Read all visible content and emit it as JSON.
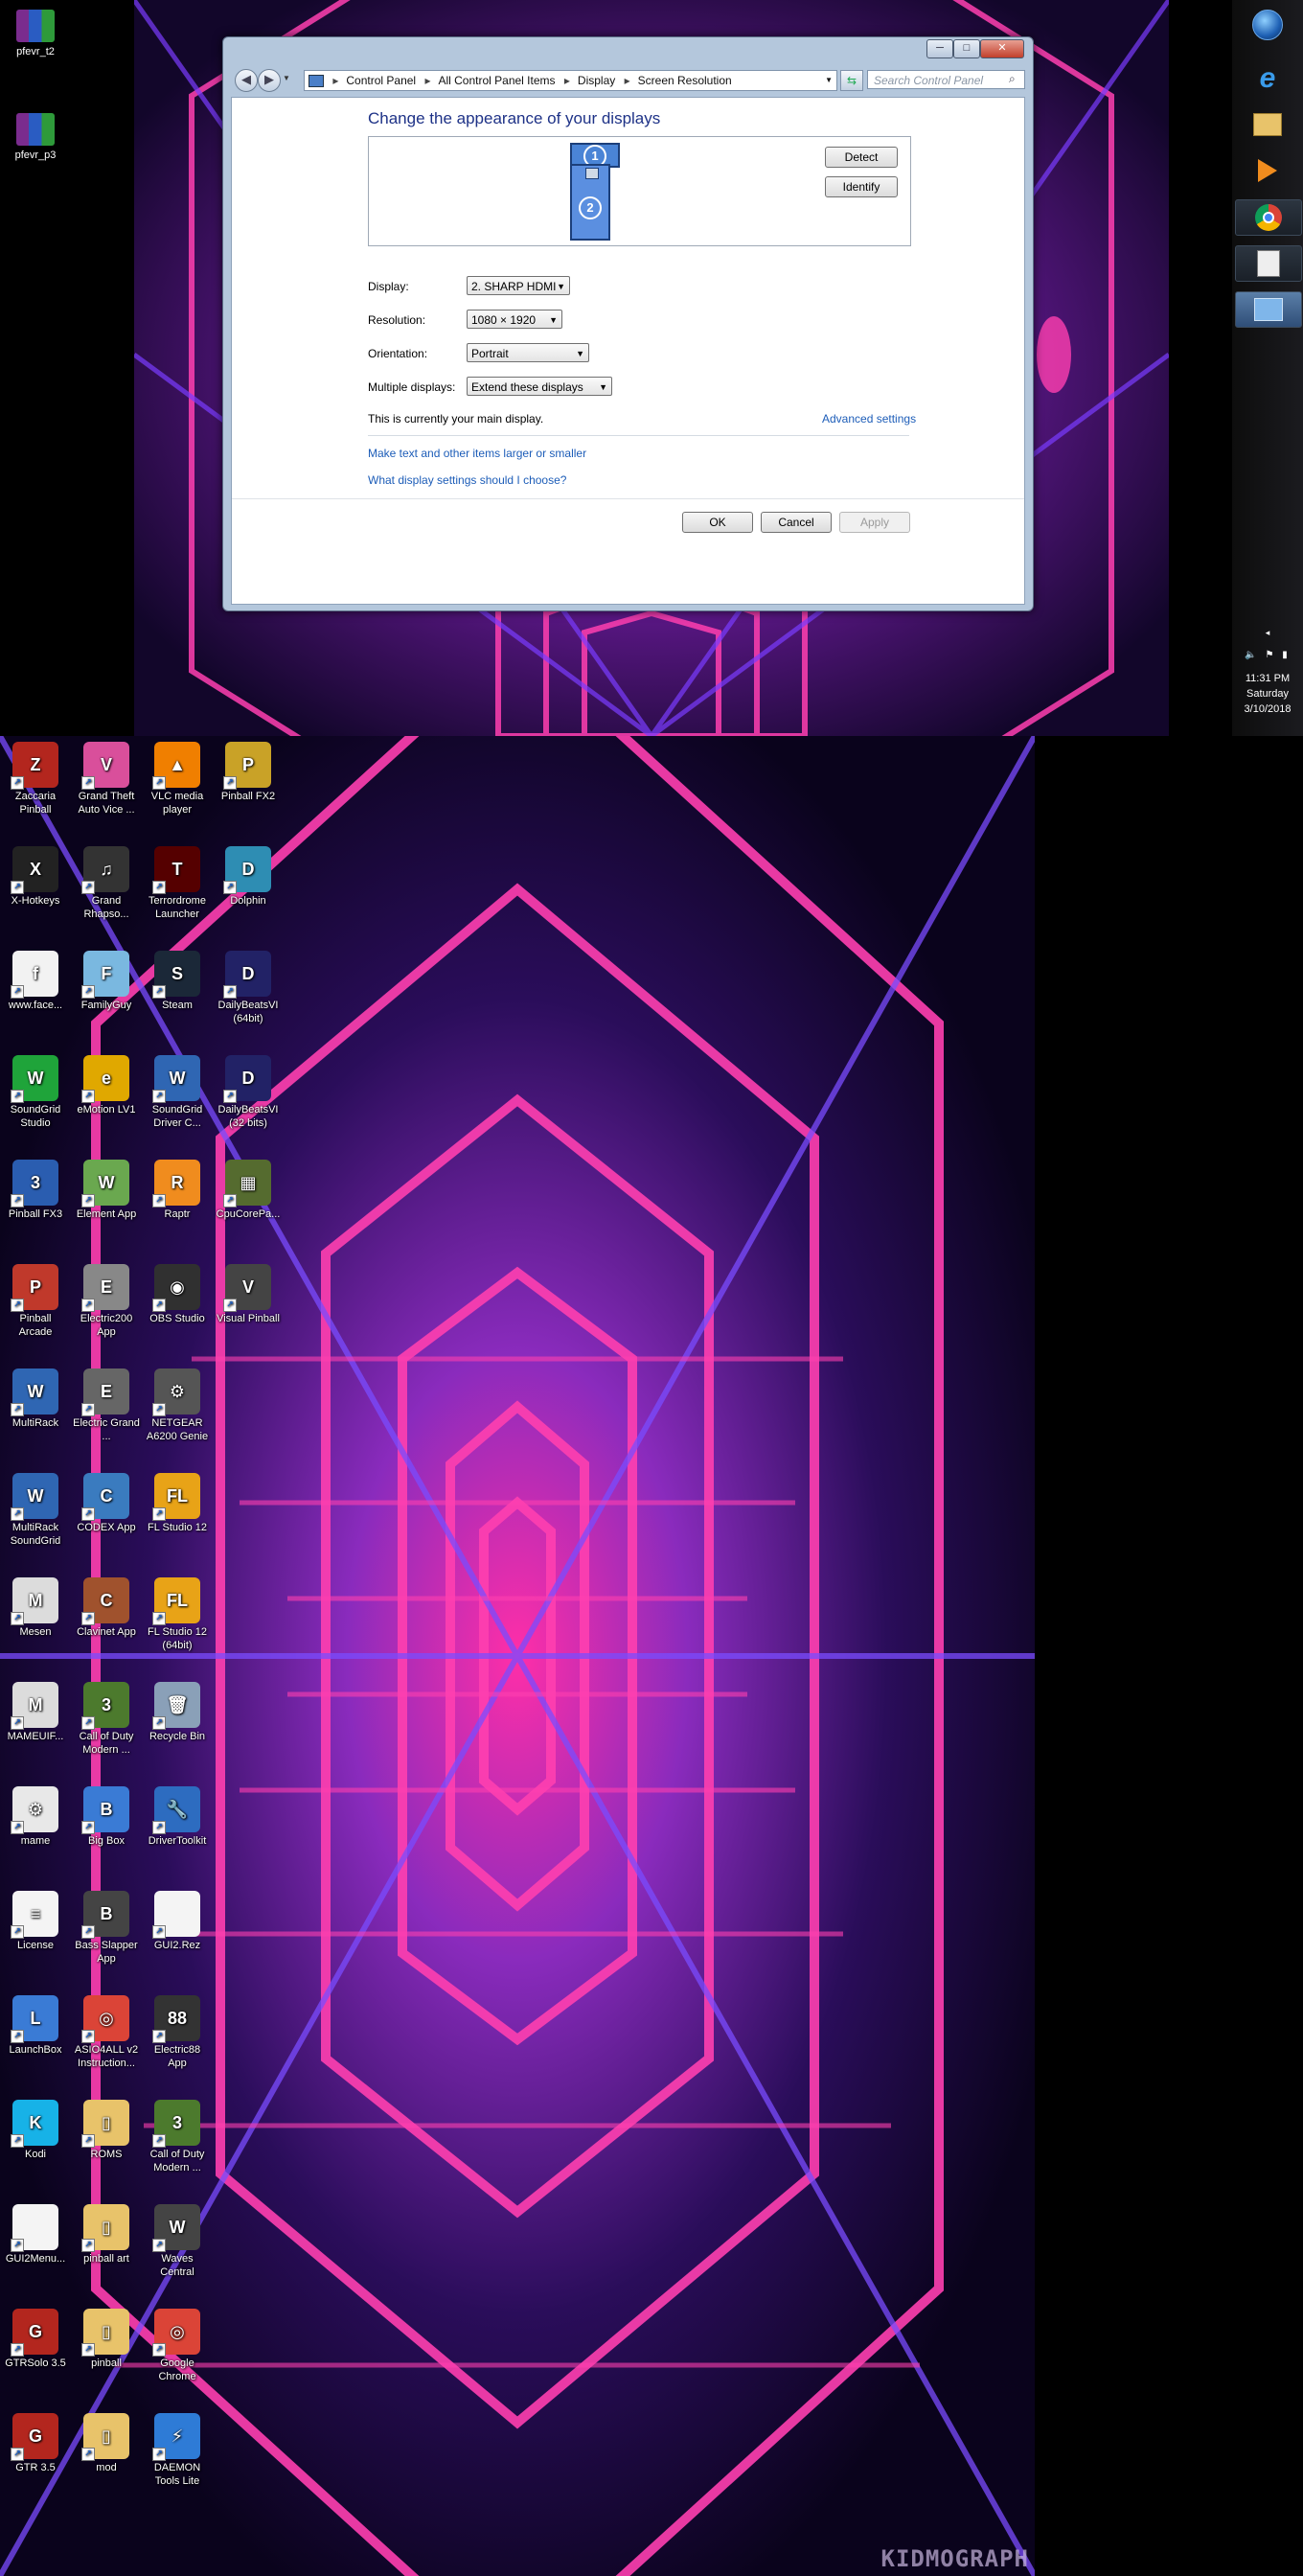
{
  "top_desktop_icons": [
    {
      "label": "pfevr_t2",
      "icon": "winrar-archive-icon"
    },
    {
      "label": "pfevr_p3",
      "icon": "winrar-archive-icon"
    }
  ],
  "window": {
    "breadcrumbs": [
      "Control Panel",
      "All Control Panel Items",
      "Display",
      "Screen Resolution"
    ],
    "search_placeholder": "Search Control Panel",
    "heading": "Change the appearance of your displays",
    "monitor_1": "1",
    "monitor_2": "2",
    "detect_label": "Detect",
    "identify_label": "Identify",
    "fields": {
      "display_label": "Display:",
      "display_value": "2. SHARP HDMI",
      "resolution_label": "Resolution:",
      "resolution_value": "1080 × 1920",
      "orientation_label": "Orientation:",
      "orientation_value": "Portrait",
      "multiple_label": "Multiple displays:",
      "multiple_value": "Extend these displays"
    },
    "main_display_note": "This is currently your main display.",
    "advanced_link": "Advanced settings",
    "link_larger_text": "Make text and other items larger or smaller",
    "link_which_settings": "What display settings should I choose?",
    "ok_label": "OK",
    "cancel_label": "Cancel",
    "apply_label": "Apply"
  },
  "taskbar": {
    "items": [
      "start-orb-icon",
      "internet-explorer-icon",
      "file-explorer-icon",
      "media-player-icon",
      "chrome-icon",
      "app-icon",
      "network-app-icon"
    ],
    "clock_time": "11:31 PM",
    "clock_day": "Saturday",
    "clock_date": "3/10/2018"
  },
  "desktop_icons": [
    {
      "label": "Zaccaria Pinball",
      "color": "#b3261e",
      "glyph": "Z"
    },
    {
      "label": "Grand Theft Auto Vice ...",
      "color": "#d94f9b",
      "glyph": "V"
    },
    {
      "label": "VLC media player",
      "color": "#f07f00",
      "glyph": "▲"
    },
    {
      "label": "Pinball FX2",
      "color": "#c9a227",
      "glyph": "P"
    },
    {
      "label": "X-Hotkeys",
      "color": "#222222",
      "glyph": "X"
    },
    {
      "label": "Grand Rhapso...",
      "color": "#333333",
      "glyph": "♫"
    },
    {
      "label": "Terrordrome Launcher",
      "color": "#550000",
      "glyph": "T"
    },
    {
      "label": "Dolphin",
      "color": "#2e8db3",
      "glyph": "D"
    },
    {
      "label": "www.face...",
      "color": "#f2f2f2",
      "glyph": "f"
    },
    {
      "label": "FamilyGuy",
      "color": "#7ab8e0",
      "glyph": "F"
    },
    {
      "label": "Steam",
      "color": "#1b2838",
      "glyph": "S"
    },
    {
      "label": "DailyBeatsVI (64bit)",
      "color": "#222266",
      "glyph": "D"
    },
    {
      "label": "SoundGrid Studio",
      "color": "#1fa43a",
      "glyph": "W"
    },
    {
      "label": "eMotion LV1",
      "color": "#e0a800",
      "glyph": "e"
    },
    {
      "label": "SoundGrid Driver C...",
      "color": "#2f66b3",
      "glyph": "W"
    },
    {
      "label": "DailyBeatsVI (32 bits)",
      "color": "#222266",
      "glyph": "D"
    },
    {
      "label": "Pinball FX3",
      "color": "#2a5db0",
      "glyph": "3"
    },
    {
      "label": "Element App",
      "color": "#6aa84f",
      "glyph": "W"
    },
    {
      "label": "Raptr",
      "color": "#f08c1e",
      "glyph": "R"
    },
    {
      "label": "CpuCorePa...",
      "color": "#556b2f",
      "glyph": "▦"
    },
    {
      "label": "Pinball Arcade",
      "color": "#c0392b",
      "glyph": "P"
    },
    {
      "label": "Electric200 App",
      "color": "#888888",
      "glyph": "E"
    },
    {
      "label": "OBS Studio",
      "color": "#303030",
      "glyph": "◉"
    },
    {
      "label": "Visual Pinball",
      "color": "#444444",
      "glyph": "V"
    },
    {
      "label": "MultiRack",
      "color": "#2f66b3",
      "glyph": "W"
    },
    {
      "label": "Electric Grand ...",
      "color": "#666666",
      "glyph": "E"
    },
    {
      "label": "NETGEAR A6200 Genie",
      "color": "#555555",
      "glyph": "⚙"
    },
    {
      "label": "",
      "color": "#000000",
      "glyph": ""
    },
    {
      "label": "MultiRack SoundGrid",
      "color": "#2f66b3",
      "glyph": "W"
    },
    {
      "label": "CODEX App",
      "color": "#3a7bbf",
      "glyph": "C"
    },
    {
      "label": "FL Studio 12",
      "color": "#e8a317",
      "glyph": "FL"
    },
    {
      "label": "",
      "color": "#000000",
      "glyph": ""
    },
    {
      "label": "Mesen",
      "color": "#dcdcdc",
      "glyph": "M"
    },
    {
      "label": "Clavinet App",
      "color": "#a0522d",
      "glyph": "C"
    },
    {
      "label": "FL Studio 12 (64bit)",
      "color": "#e8a317",
      "glyph": "FL"
    },
    {
      "label": "",
      "color": "#000000",
      "glyph": ""
    },
    {
      "label": "MAMEUIF...",
      "color": "#dcdcdc",
      "glyph": "M"
    },
    {
      "label": "Call of Duty Modern ...",
      "color": "#4c7a2d",
      "glyph": "3"
    },
    {
      "label": "Recycle Bin",
      "color": "#8aa0b8",
      "glyph": "🗑"
    },
    {
      "label": "",
      "color": "#000000",
      "glyph": ""
    },
    {
      "label": "mame",
      "color": "#e8e8e8",
      "glyph": "⚙"
    },
    {
      "label": "Big Box",
      "color": "#3a7bd5",
      "glyph": "B"
    },
    {
      "label": "DriverToolkit",
      "color": "#2d6cc0",
      "glyph": "🔧"
    },
    {
      "label": "",
      "color": "#000000",
      "glyph": ""
    },
    {
      "label": "License",
      "color": "#f4f4f4",
      "glyph": "≡"
    },
    {
      "label": "Bass Slapper App",
      "color": "#444444",
      "glyph": "B"
    },
    {
      "label": "GUI2.Rez",
      "color": "#f4f4f4",
      "glyph": ""
    },
    {
      "label": "",
      "color": "#000000",
      "glyph": ""
    },
    {
      "label": "LaunchBox",
      "color": "#3a7bd5",
      "glyph": "L"
    },
    {
      "label": "ASIO4ALL v2 Instruction...",
      "color": "#db4437",
      "glyph": "◎"
    },
    {
      "label": "Electric88 App",
      "color": "#333333",
      "glyph": "88"
    },
    {
      "label": "",
      "color": "#000000",
      "glyph": ""
    },
    {
      "label": "Kodi",
      "color": "#17b2e7",
      "glyph": "K"
    },
    {
      "label": "ROMS",
      "color": "#e8c36a",
      "glyph": "▯"
    },
    {
      "label": "Call of Duty Modern ...",
      "color": "#4c7a2d",
      "glyph": "3"
    },
    {
      "label": "",
      "color": "#000000",
      "glyph": ""
    },
    {
      "label": "GUI2Menu...",
      "color": "#f4f4f4",
      "glyph": ""
    },
    {
      "label": "pinball art",
      "color": "#e8c36a",
      "glyph": "▯"
    },
    {
      "label": "Waves Central",
      "color": "#444444",
      "glyph": "W"
    },
    {
      "label": "",
      "color": "#000000",
      "glyph": ""
    },
    {
      "label": "GTRSolo 3.5",
      "color": "#b3261e",
      "glyph": "G"
    },
    {
      "label": "pinball",
      "color": "#e8c36a",
      "glyph": "▯"
    },
    {
      "label": "Google Chrome",
      "color": "#db4437",
      "glyph": "◎"
    },
    {
      "label": "",
      "color": "#000000",
      "glyph": ""
    },
    {
      "label": "GTR 3.5",
      "color": "#b3261e",
      "glyph": "G"
    },
    {
      "label": "mod",
      "color": "#e8c36a",
      "glyph": "▯"
    },
    {
      "label": "DAEMON Tools Lite",
      "color": "#2e7bd6",
      "glyph": "⚡"
    }
  ],
  "watermark": "KIDMOGRAPH"
}
